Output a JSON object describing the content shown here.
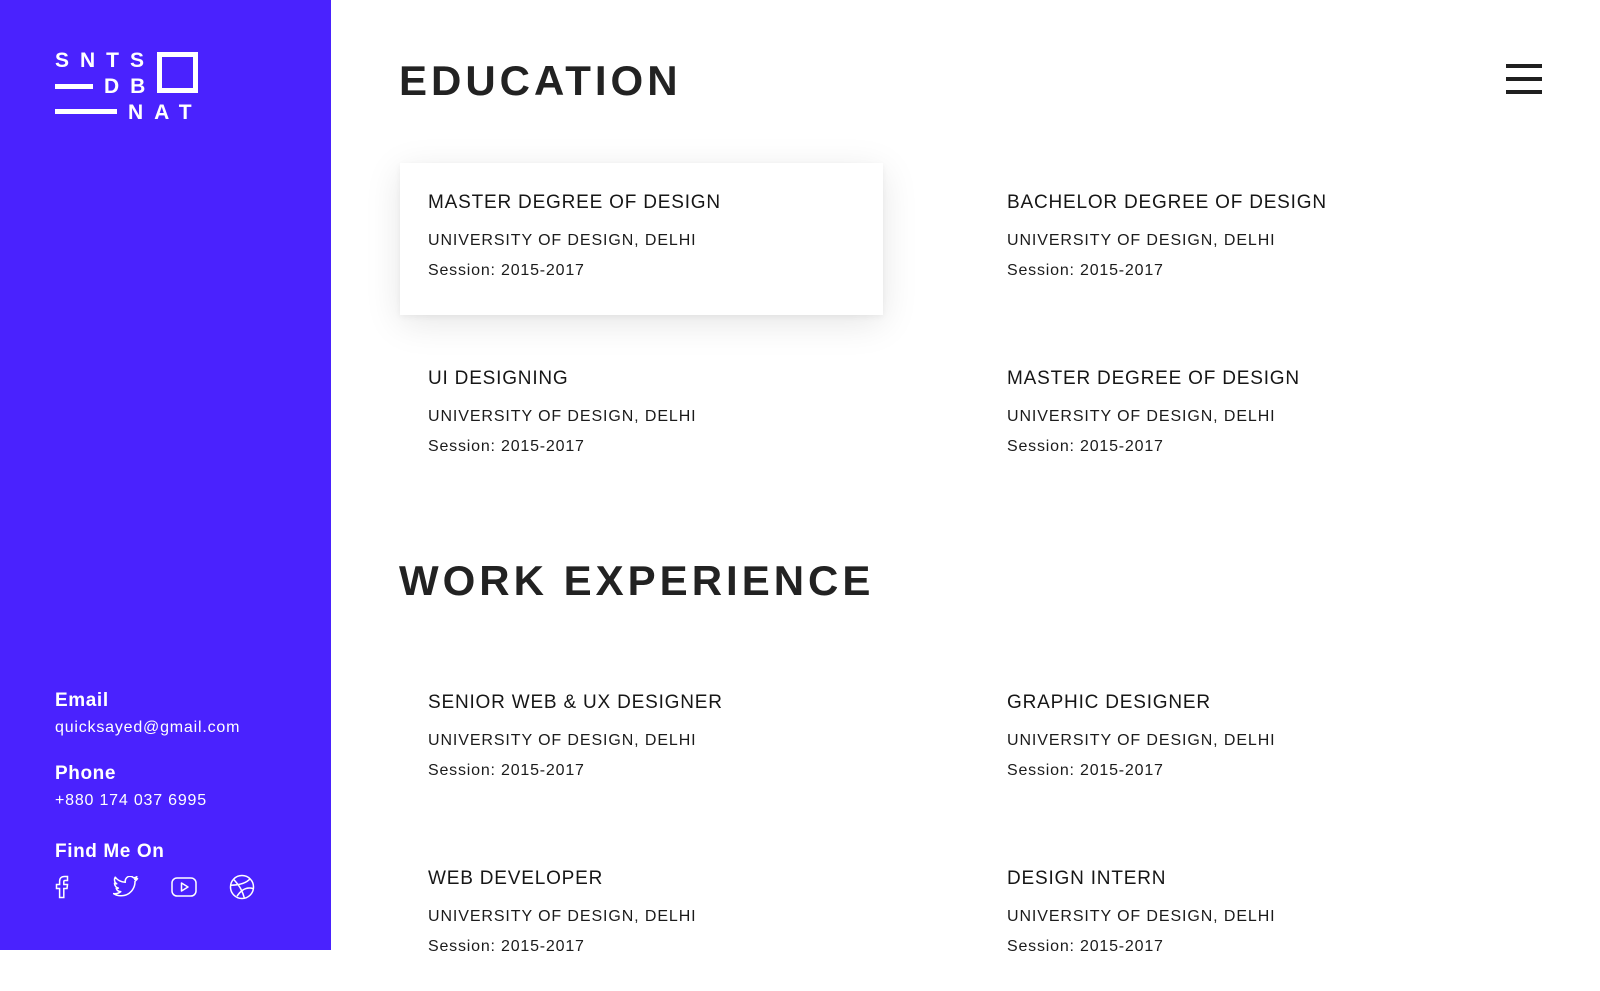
{
  "logo": {
    "line1": "SNTS",
    "line2": "DB",
    "line3": "NAT"
  },
  "sidebar": {
    "email_label": "Email",
    "email_value": "quicksayed@gmail.com",
    "phone_label": "Phone",
    "phone_value": "+880 174 037 6995",
    "social_label": "Find Me On",
    "social_icons": [
      "facebook-icon",
      "twitter-icon",
      "youtube-icon",
      "dribbble-icon"
    ]
  },
  "colors": {
    "sidebar_bg": "#4a22fe",
    "heading": "#222222",
    "text": "#1b1b1b"
  },
  "education": {
    "title": "EDUCATION",
    "items": [
      {
        "title": "MASTER DEGREE OF DESIGN",
        "institution": "UNIVERSITY OF DESIGN, DELHI",
        "session": "Session: 2015-2017"
      },
      {
        "title": "BACHELOR DEGREE OF DESIGN",
        "institution": "UNIVERSITY OF DESIGN, DELHI",
        "session": "Session: 2015-2017"
      },
      {
        "title": "UI DESIGNING",
        "institution": "UNIVERSITY OF DESIGN, DELHI",
        "session": "Session: 2015-2017"
      },
      {
        "title": "MASTER DEGREE OF DESIGN",
        "institution": "UNIVERSITY OF DESIGN, DELHI",
        "session": "Session: 2015-2017"
      }
    ]
  },
  "work": {
    "title": "WORK EXPERIENCE",
    "items": [
      {
        "title": "SENIOR WEB & UX DESIGNER",
        "institution": "UNIVERSITY OF DESIGN, DELHI",
        "session": "Session: 2015-2017"
      },
      {
        "title": "GRAPHIC DESIGNER",
        "institution": "UNIVERSITY OF DESIGN, DELHI",
        "session": "Session: 2015-2017"
      },
      {
        "title": "WEB DEVELOPER",
        "institution": "UNIVERSITY OF DESIGN, DELHI",
        "session": "Session: 2015-2017"
      },
      {
        "title": "DESIGN INTERN",
        "institution": "UNIVERSITY OF DESIGN, DELHI",
        "session": "Session: 2015-2017"
      }
    ]
  }
}
